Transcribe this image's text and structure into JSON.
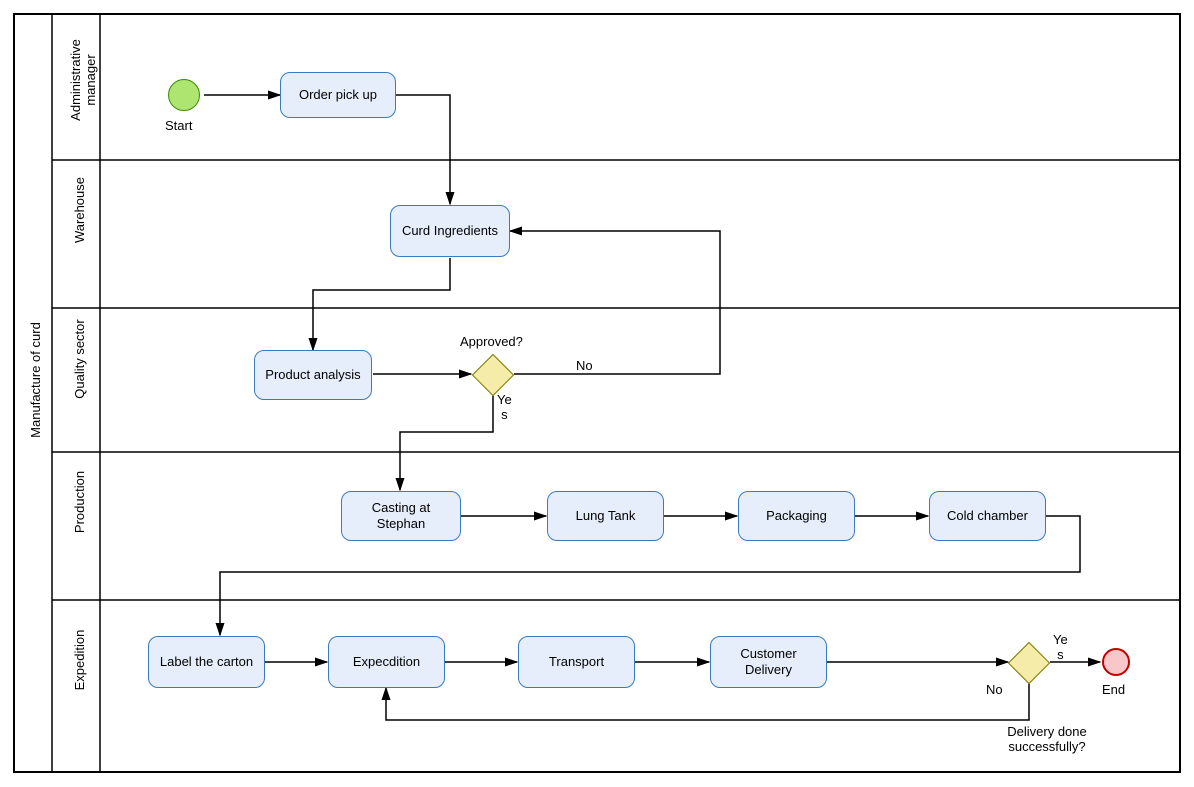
{
  "pool_title": "Manufacture of curd",
  "lanes": {
    "admin": "Administrative\nmanager",
    "warehouse": "Warehouse",
    "quality": "Quality sector",
    "production": "Production",
    "expedition": "Expedition"
  },
  "nodes": {
    "start_label": "Start",
    "order_pickup": "Order pick up",
    "curd_ingredients": "Curd\nIngredients",
    "product_analysis": "Product\nanalysis",
    "gateway1_label": "Approved?",
    "gateway1_yes": "Ye\ns",
    "gateway1_no": "No",
    "casting": "Casting at\nStephan",
    "lung_tank": "Lung Tank",
    "packaging": "Packaging",
    "cold_chamber": "Cold chamber",
    "label_carton": "Label the\ncarton",
    "expedition": "Expecdition",
    "transport": "Transport",
    "customer_delivery": "Customer\nDelivery",
    "gateway2_label": "Delivery done\nsuccessfully?",
    "gateway2_yes": "Ye\ns",
    "gateway2_no": "No",
    "end_label": "End"
  },
  "chart_data": {
    "type": "bpmn_swimlane",
    "pool": "Manufacture of curd",
    "lanes": [
      "Administrative manager",
      "Warehouse",
      "Quality sector",
      "Production",
      "Expedition"
    ],
    "nodes": [
      {
        "id": "start",
        "type": "start-event",
        "lane": "Administrative manager",
        "label": "Start"
      },
      {
        "id": "order_pickup",
        "type": "task",
        "lane": "Administrative manager",
        "label": "Order pick up"
      },
      {
        "id": "curd_ingredients",
        "type": "task",
        "lane": "Warehouse",
        "label": "Curd Ingredients"
      },
      {
        "id": "product_analysis",
        "type": "task",
        "lane": "Quality sector",
        "label": "Product analysis"
      },
      {
        "id": "gw_approved",
        "type": "gateway",
        "lane": "Quality sector",
        "label": "Approved?"
      },
      {
        "id": "casting",
        "type": "task",
        "lane": "Production",
        "label": "Casting at Stephan"
      },
      {
        "id": "lung_tank",
        "type": "task",
        "lane": "Production",
        "label": "Lung Tank"
      },
      {
        "id": "packaging",
        "type": "task",
        "lane": "Production",
        "label": "Packaging"
      },
      {
        "id": "cold_chamber",
        "type": "task",
        "lane": "Production",
        "label": "Cold chamber"
      },
      {
        "id": "label_carton",
        "type": "task",
        "lane": "Expedition",
        "label": "Label the carton"
      },
      {
        "id": "expedition",
        "type": "task",
        "lane": "Expedition",
        "label": "Expecdition"
      },
      {
        "id": "transport",
        "type": "task",
        "lane": "Expedition",
        "label": "Transport"
      },
      {
        "id": "customer_delivery",
        "type": "task",
        "lane": "Expedition",
        "label": "Customer Delivery"
      },
      {
        "id": "gw_delivery",
        "type": "gateway",
        "lane": "Expedition",
        "label": "Delivery done successfully?"
      },
      {
        "id": "end",
        "type": "end-event",
        "lane": "Expedition",
        "label": "End"
      }
    ],
    "edges": [
      {
        "from": "start",
        "to": "order_pickup"
      },
      {
        "from": "order_pickup",
        "to": "curd_ingredients"
      },
      {
        "from": "curd_ingredients",
        "to": "product_analysis"
      },
      {
        "from": "product_analysis",
        "to": "gw_approved"
      },
      {
        "from": "gw_approved",
        "to": "curd_ingredients",
        "label": "No"
      },
      {
        "from": "gw_approved",
        "to": "casting",
        "label": "Yes"
      },
      {
        "from": "casting",
        "to": "lung_tank"
      },
      {
        "from": "lung_tank",
        "to": "packaging"
      },
      {
        "from": "packaging",
        "to": "cold_chamber"
      },
      {
        "from": "cold_chamber",
        "to": "label_carton"
      },
      {
        "from": "label_carton",
        "to": "expedition"
      },
      {
        "from": "expedition",
        "to": "transport"
      },
      {
        "from": "transport",
        "to": "customer_delivery"
      },
      {
        "from": "customer_delivery",
        "to": "gw_delivery"
      },
      {
        "from": "gw_delivery",
        "to": "end",
        "label": "Yes"
      },
      {
        "from": "gw_delivery",
        "to": "expedition",
        "label": "No"
      }
    ]
  }
}
